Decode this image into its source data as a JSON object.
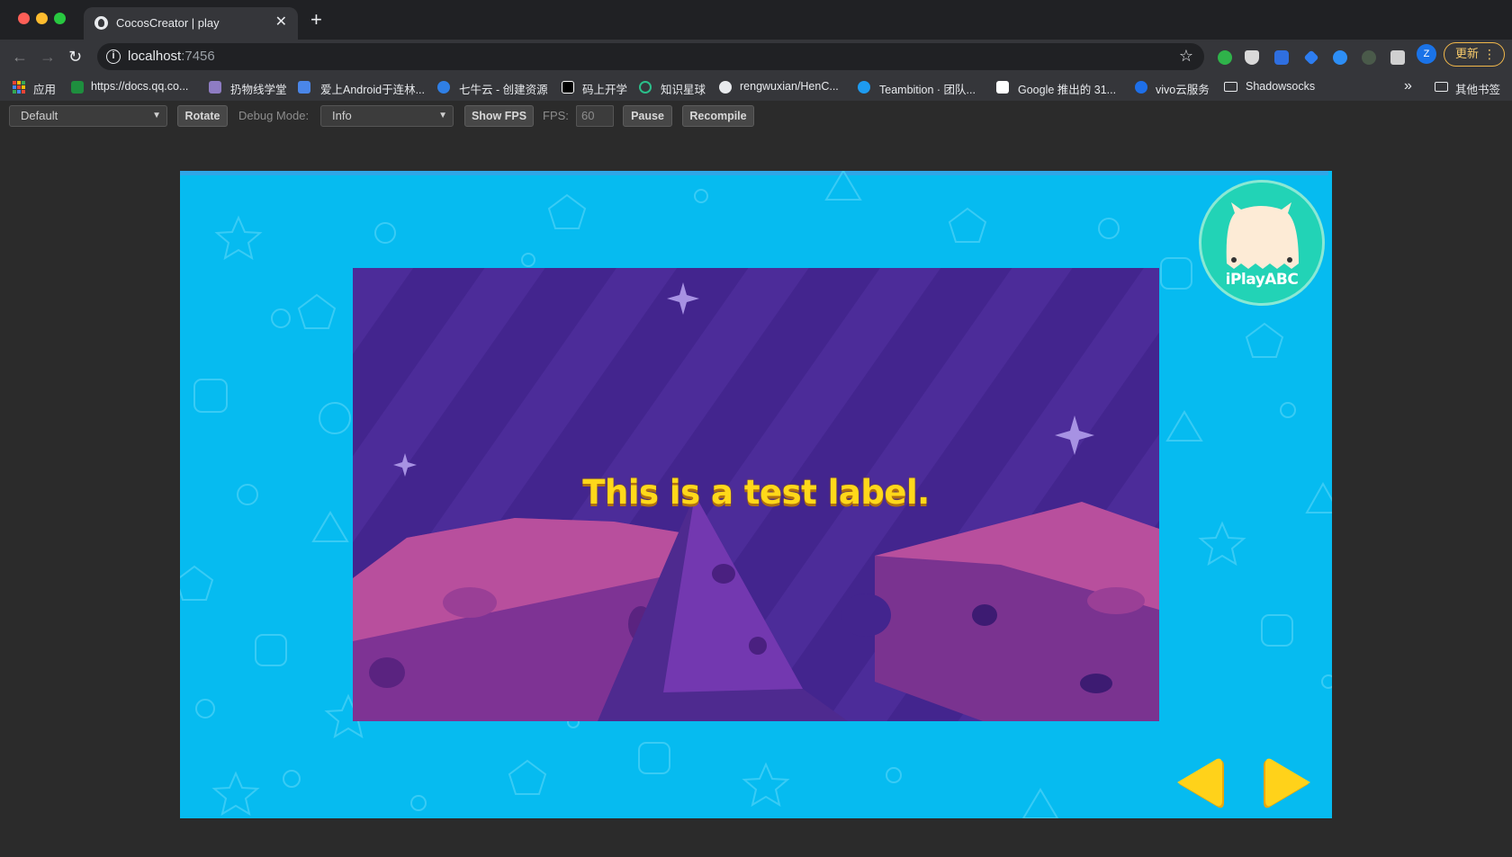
{
  "browser": {
    "tab_title": "CocosCreator | play",
    "url_host": "localhost",
    "url_port": ":7456",
    "update_label": "更新",
    "profile_initial": "Z"
  },
  "bookmarks": {
    "apps_label": "应用",
    "items": [
      "https://docs.qq.co...",
      "扔物线学堂",
      "爱上Android于连林...",
      "七牛云 - 创建资源",
      "码上开学",
      "知识星球",
      "rengwuxian/HenC...",
      "Teambition · 团队...",
      "Google 推出的 31...",
      "vivo云服务",
      "Shadowsocks"
    ],
    "overflow": "»",
    "other_label": "其他书签"
  },
  "cocos_toolbar": {
    "device_select": "Default",
    "rotate_label": "Rotate",
    "debug_mode_label": "Debug Mode:",
    "debug_select": "Info",
    "show_fps_label": "Show FPS",
    "fps_label": "FPS:",
    "fps_value": "60",
    "pause_label": "Pause",
    "recompile_label": "Recompile"
  },
  "game": {
    "label_text": "This is a test label.",
    "logo_text": "iPlayABC",
    "colors": {
      "background": "#06bbf0",
      "stage": "#43258e",
      "label": "#ffd81a",
      "arrow": "#ffd21a"
    }
  }
}
